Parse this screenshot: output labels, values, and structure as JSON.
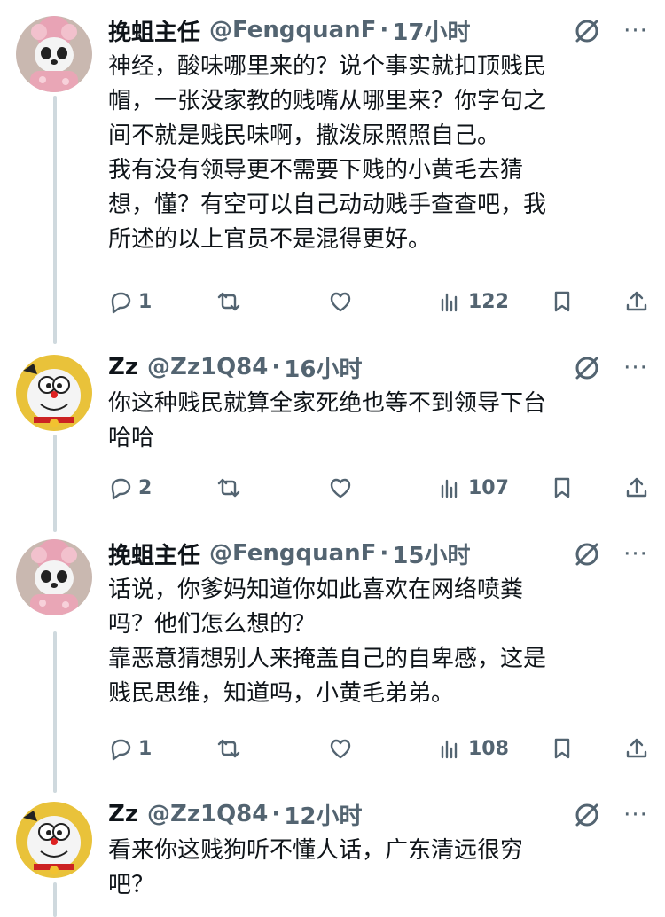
{
  "tweets": [
    {
      "display_name": "挽蛆主任",
      "handle": "@FengquanF",
      "dot": "·",
      "time": "17小时",
      "text": "神经，酸味哪里来的？说个事实就扣顶贱民\n帽，一张没家教的贱嘴从哪里来？你字句之\n间不就是贱民味啊，撒泼尿照照自己。\n我有没有领导更不需要下贱的小黄毛去猜\n想，懂？有空可以自己动动贱手查查吧，我\n所述的以上官员不是混得更好。",
      "replies": "1",
      "retweets": "",
      "likes": "",
      "views": "122",
      "avatar": "panda-avatar"
    },
    {
      "display_name": "Zz",
      "handle": "@Zz1Q84",
      "dot": "·",
      "time": "16小时",
      "text": "你这种贱民就算全家死绝也等不到领导下台\n哈哈",
      "replies": "2",
      "retweets": "",
      "likes": "",
      "views": "107",
      "avatar": "doraemon-avatar"
    },
    {
      "display_name": "挽蛆主任",
      "handle": "@FengquanF",
      "dot": "·",
      "time": "15小时",
      "text": "话说，你爹妈知道你如此喜欢在网络喷粪\n吗？他们怎么想的？\n靠恶意猜想别人来掩盖自己的自卑感，这是\n贱民思维，知道吗，小黄毛弟弟。",
      "replies": "1",
      "retweets": "",
      "likes": "",
      "views": "108",
      "avatar": "panda-avatar"
    },
    {
      "display_name": "Zz",
      "handle": "@Zz1Q84",
      "dot": "·",
      "time": "12小时",
      "text": "看来你这贱狗听不懂人话，广东清远很穷\n吧？",
      "avatar": "doraemon-avatar"
    }
  ],
  "icons": {
    "reply": "reply-icon",
    "retweet": "retweet-icon",
    "like": "like-icon",
    "views": "views-icon",
    "bookmark": "bookmark-icon",
    "share": "share-icon",
    "grok": "grok-icon",
    "more": "more-icon"
  },
  "colors": {
    "text": "#0f1419",
    "secondary": "#536471",
    "thread_line": "#cfd9de"
  }
}
